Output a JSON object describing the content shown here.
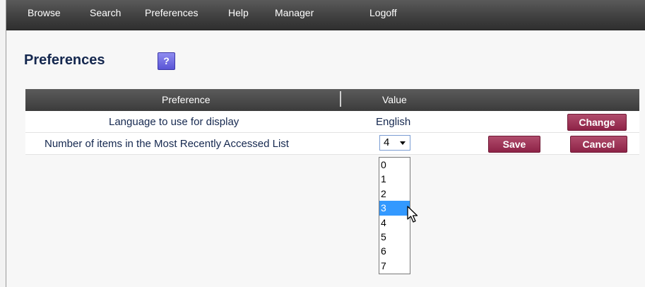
{
  "nav": [
    "Browse",
    "Search",
    "Preferences",
    "Help",
    "Manager",
    "Logoff"
  ],
  "page": {
    "title": "Preferences",
    "help_label": "?"
  },
  "table": {
    "headers": {
      "preference": "Preference",
      "value": "Value"
    },
    "rows": [
      {
        "label": "Language to use for display",
        "value": "English",
        "button": "Change"
      },
      {
        "label": "Number of items in the Most Recently Accessed List",
        "selected": "4",
        "save": "Save",
        "cancel": "Cancel"
      }
    ]
  },
  "dropdown": {
    "options": [
      "0",
      "1",
      "2",
      "3",
      "4",
      "5",
      "6",
      "7"
    ],
    "highlighted": "3"
  },
  "colors": {
    "button": "#9a2f52",
    "topbar": "#3e3e3e",
    "highlight": "#3399ff",
    "title": "#15284f"
  }
}
